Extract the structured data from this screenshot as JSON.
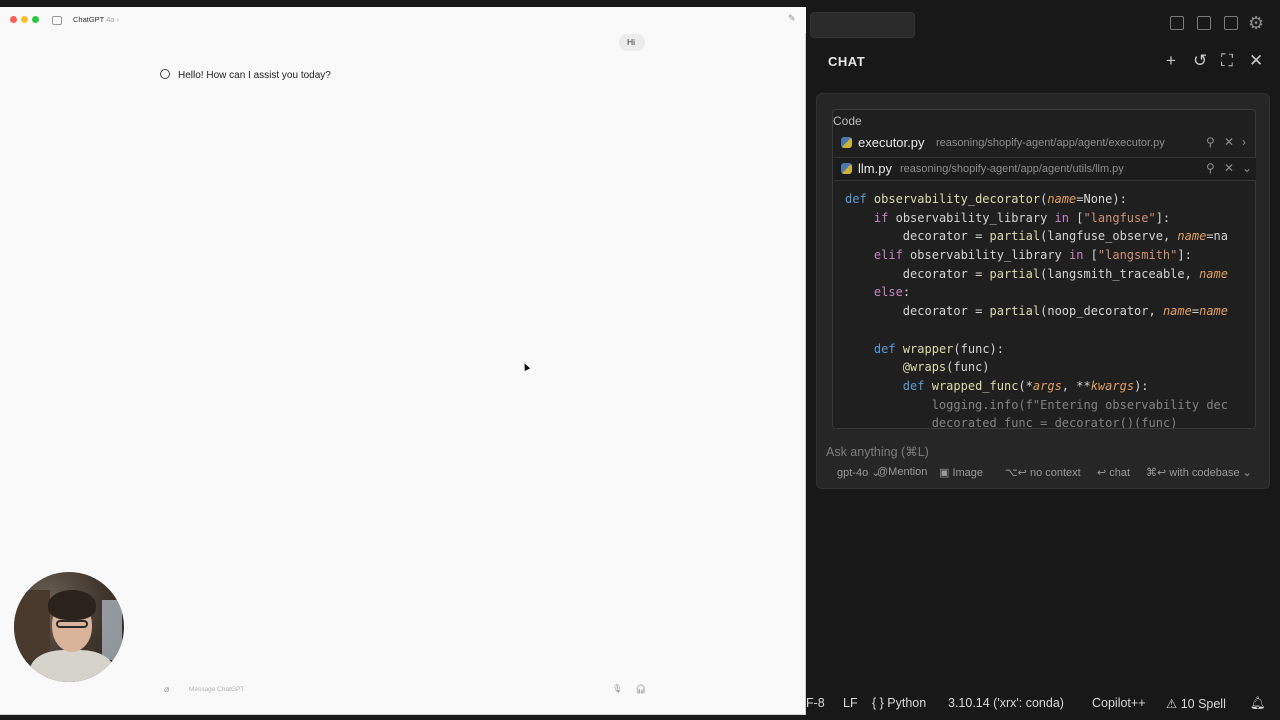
{
  "gpt": {
    "title": "ChatGPT",
    "model": "4o",
    "user_message": "Hi",
    "assistant_message": "Hello! How can I assist you today?",
    "composer_placeholder": "Message ChatGPT"
  },
  "ide": {
    "chat_title": "CHAT",
    "code_label": "Code",
    "files": [
      {
        "name": "executor.py",
        "path": "reasoning/shopify-agent/app/agent/executor.py"
      },
      {
        "name": "llm.py",
        "path": "reasoning/shopify-agent/app/agent/utils/llm.py"
      }
    ],
    "code_lines": [
      "def observability_decorator(name=None):",
      "    if observability_library in [\"langfuse\"]:",
      "        decorator = partial(langfuse_observe, name=na",
      "    elif observability_library in [\"langsmith\"]:",
      "        decorator = partial(langsmith_traceable, name",
      "    else:",
      "        decorator = partial(noop_decorator, name=name",
      "",
      "    def wrapper(func):",
      "        @wraps(func)",
      "        def wrapped_func(*args, **kwargs):",
      "            logging.info(f\"Entering observability dec",
      "            decorated_func = decorator()(func)"
    ],
    "ask_placeholder": "Ask anything (⌘L)",
    "toolbar": {
      "model": "gpt-4o",
      "mention": "Mention",
      "image": "Image",
      "no_context": "no context",
      "chat": "chat",
      "codebase": "with codebase",
      "no_context_key": "⌥↩",
      "chat_key": "↩",
      "codebase_key": "⌘↩"
    },
    "statusbar": {
      "encoding": "F-8",
      "eol": "LF",
      "language": "Python",
      "interpreter": "3.10.14 ('xrx': conda)",
      "copilot": "Copilot++",
      "spell": "10 Spell"
    }
  }
}
